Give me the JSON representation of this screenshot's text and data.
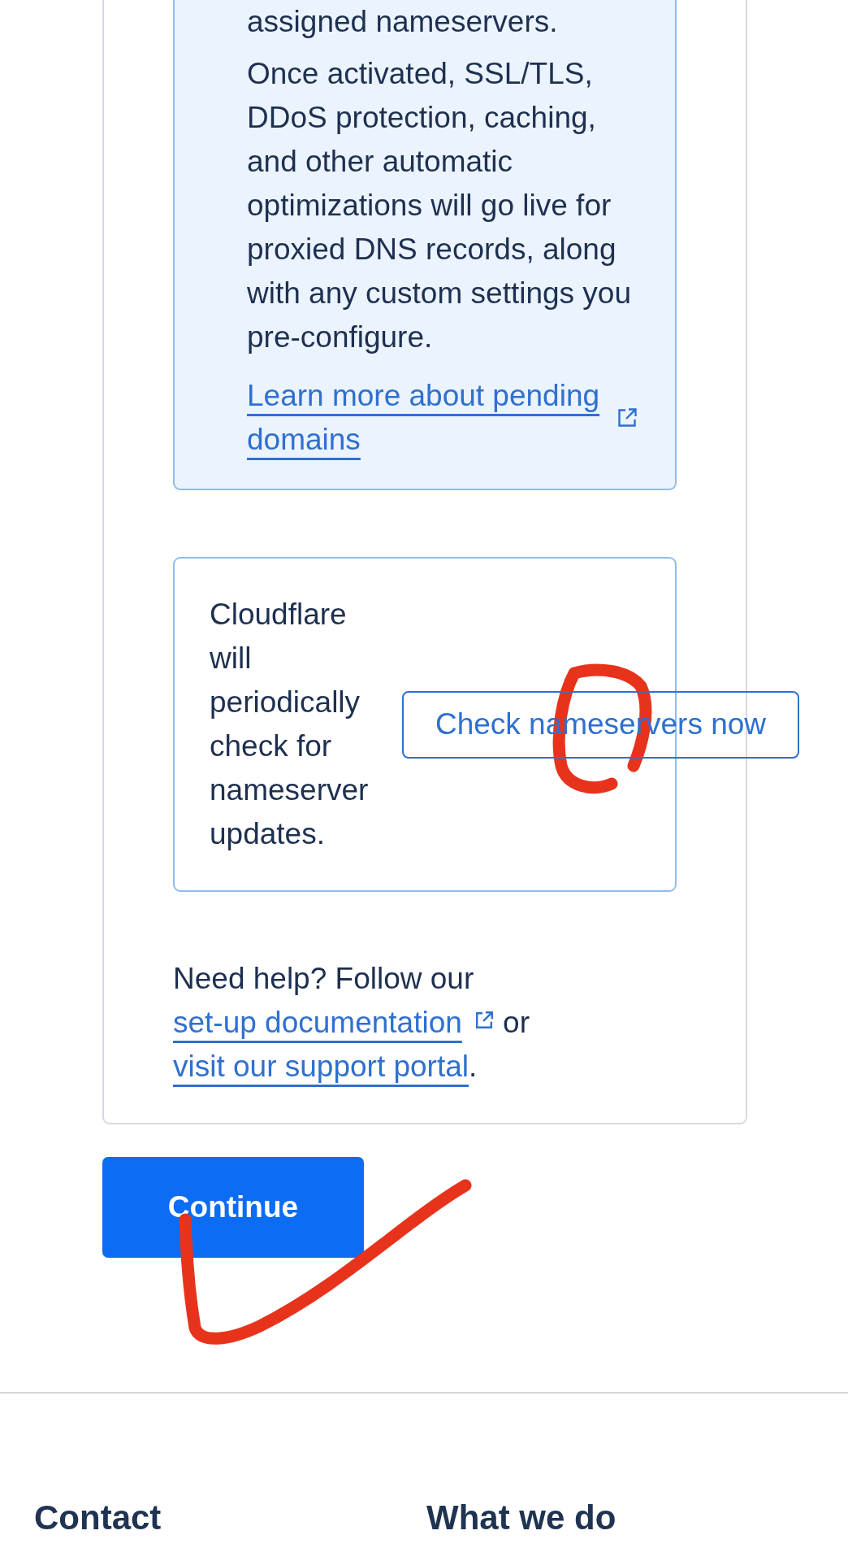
{
  "pending_notice": {
    "paragraphs": [
      "assigned nameservers.",
      "Once activated, SSL/TLS, DDoS protection, caching, and other automatic optimizations will go live for proxied DNS records, along with any custom settings you pre-configure."
    ],
    "link": {
      "label": "Learn more about pending domains",
      "external": true
    }
  },
  "nameserver_check": {
    "message": "Cloudflare will periodically check for nameserver updates.",
    "button": "Check nameservers now",
    "annotation": {
      "kind": "loop"
    }
  },
  "help": {
    "parts": [
      {
        "kind": "text",
        "text": "Need help? Follow our "
      },
      {
        "kind": "link",
        "text": "set-up documentation",
        "external": true
      },
      {
        "kind": "text",
        "text": " or "
      },
      {
        "kind": "link",
        "text": "visit our support portal",
        "external": false
      },
      {
        "kind": "text",
        "text": "."
      }
    ]
  },
  "continue": {
    "label": "Continue",
    "annotation": {
      "kind": "check"
    }
  },
  "footer": {
    "headings": [
      "Contact",
      "What we do"
    ]
  }
}
